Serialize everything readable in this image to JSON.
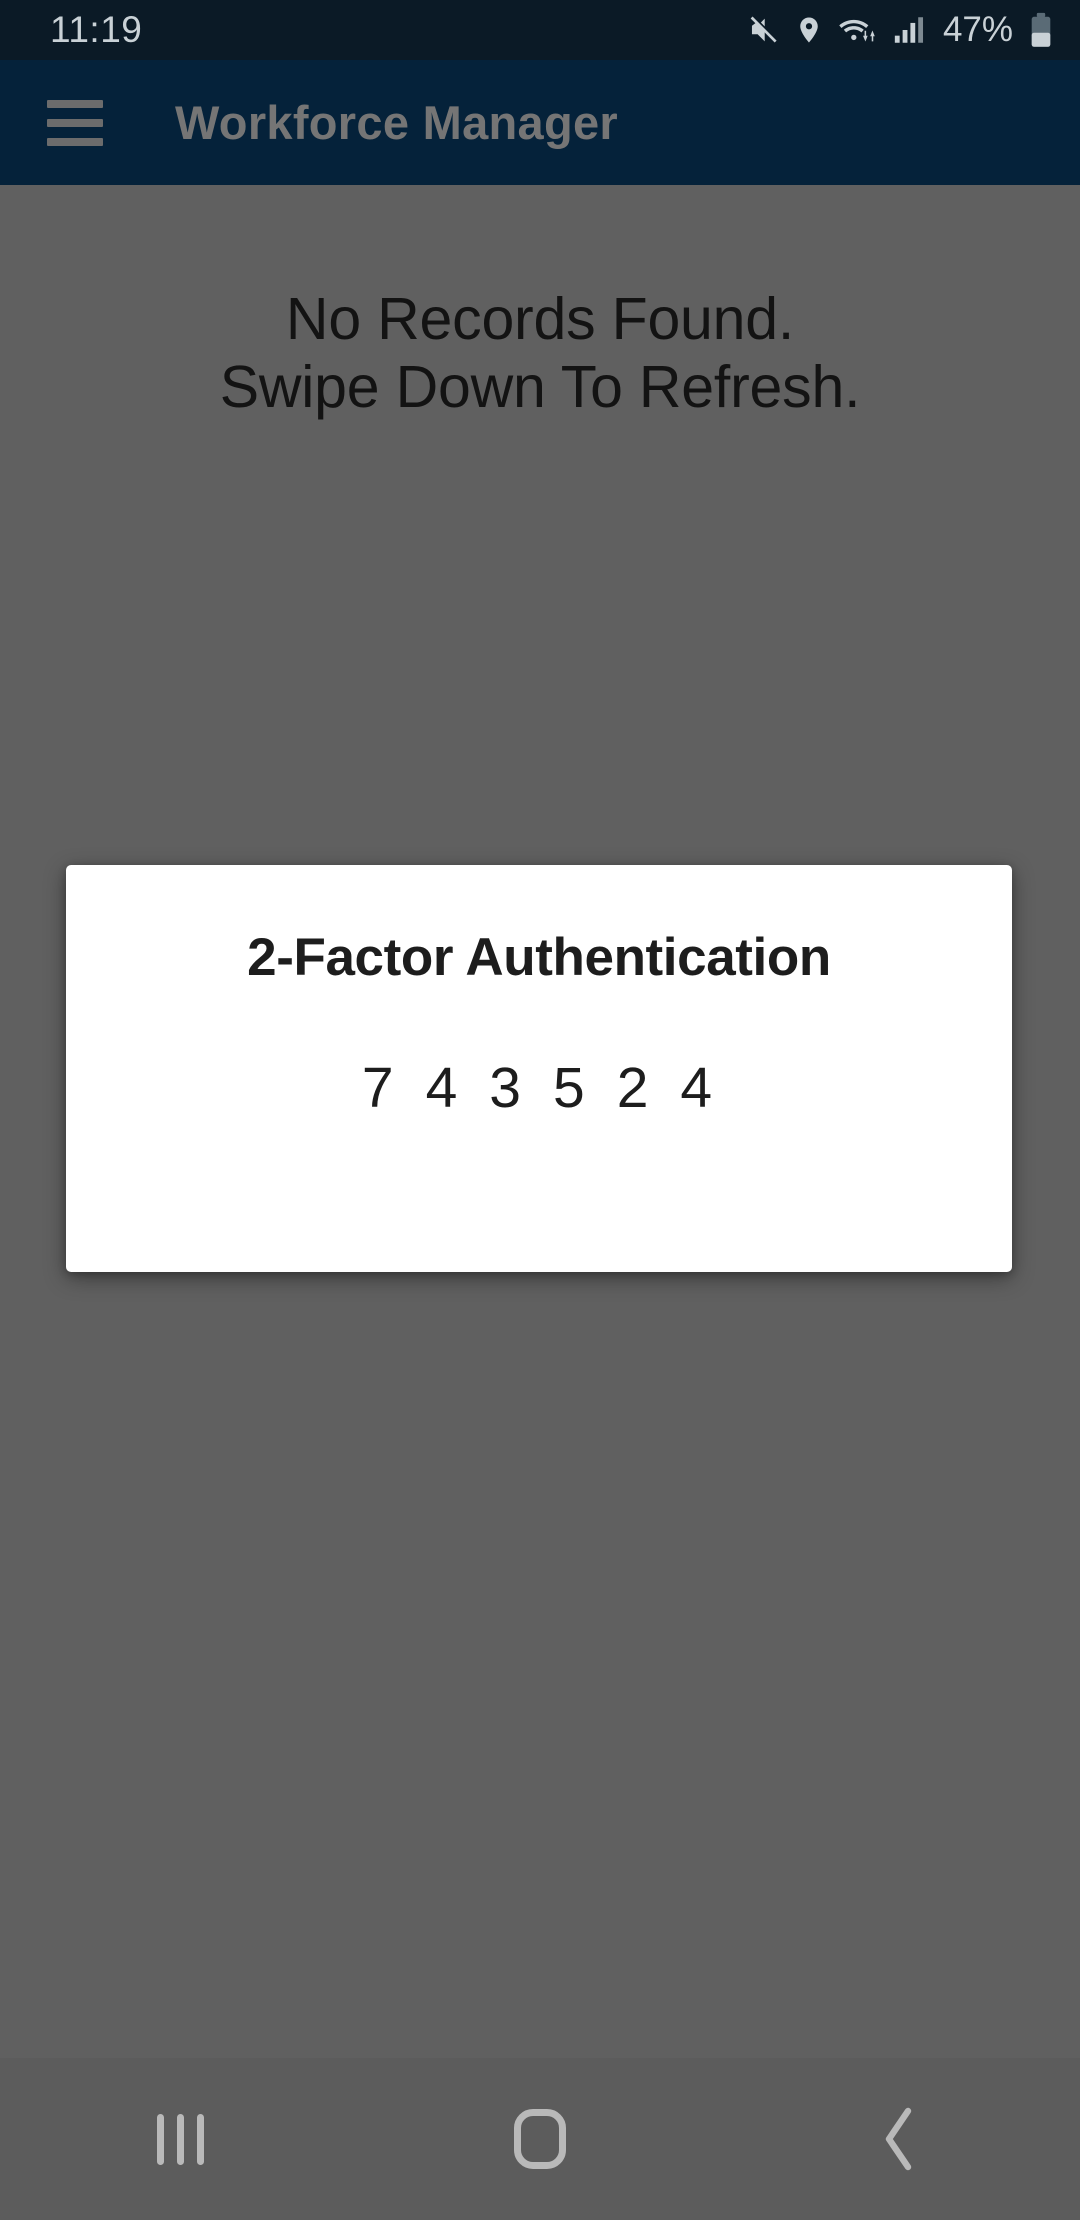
{
  "status_bar": {
    "time": "11:19",
    "battery_percent": "47%",
    "icons": [
      "mute-icon",
      "location-pin-icon",
      "wifi-icon",
      "cellular-signal-icon",
      "battery-icon"
    ]
  },
  "app_bar": {
    "menu_icon": "hamburger-menu-icon",
    "title": "Workforce Manager"
  },
  "content": {
    "empty_message_line1": "No Records Found.",
    "empty_message_line2": "Swipe Down To Refresh."
  },
  "dialog": {
    "title": "2-Factor Authentication",
    "code_digits": [
      "7",
      "4",
      "3",
      "5",
      "2",
      "4"
    ],
    "code": "743524"
  },
  "nav_bar": {
    "recents_label": "Recents",
    "home_label": "Home",
    "back_label": "Back"
  },
  "colors": {
    "status_bar_bg": "#0b1a26",
    "app_bar_bg": "#05223a",
    "scrim": "#606060",
    "dialog_bg": "#ffffff",
    "nav_bar_bg": "#5c5c5c",
    "text_dark": "#131313",
    "app_title_dim": "#757575"
  }
}
